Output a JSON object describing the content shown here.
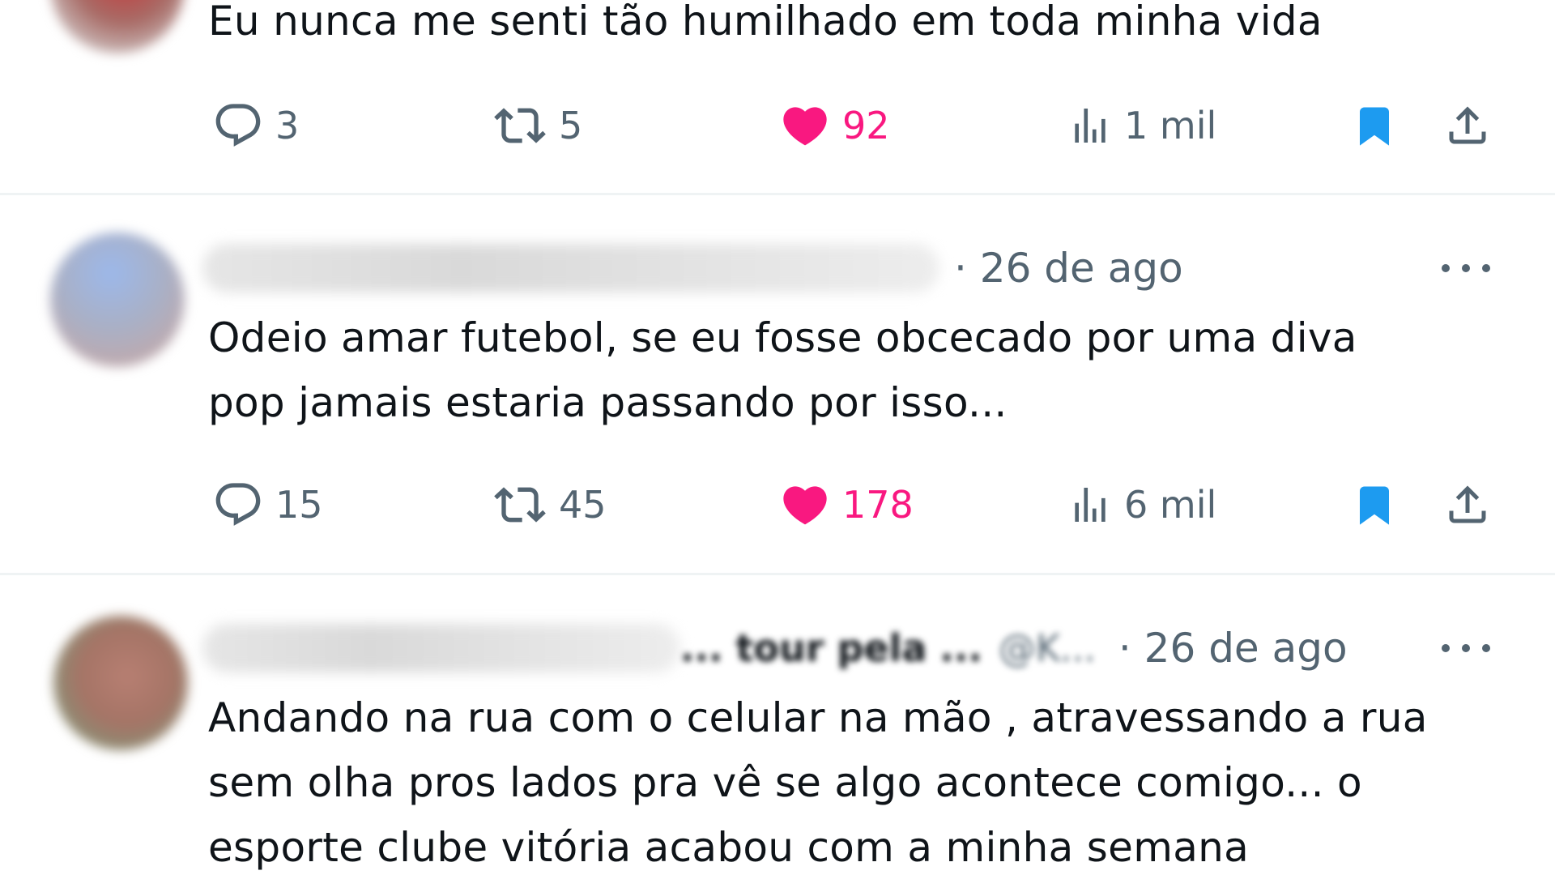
{
  "tweets": [
    {
      "text_lines": [
        "Eu nunca me senti tão humilhado em toda minha vida"
      ],
      "stats": {
        "replies": "3",
        "retweets": "5",
        "likes": "92",
        "views": "1 mil"
      }
    },
    {
      "date": "· 26 de ago",
      "text_lines": [
        "Odeio amar futebol, se eu fosse obcecado por uma diva",
        "pop jamais estaria passando por isso..."
      ],
      "stats": {
        "replies": "15",
        "retweets": "45",
        "likes": "178",
        "views": "6 mil"
      }
    },
    {
      "name_fragment": "... tour pela ...",
      "handle_fragment": "@K...",
      "date": "· 26 de ago",
      "text_lines": [
        "Andando na rua com o celular na mão , atravessando a rua",
        "sem olha pros lados pra vê se algo acontece comigo... o",
        "esporte clube vitória acabou com a minha semana"
      ]
    }
  ],
  "icons": {
    "reply": "reply-icon",
    "retweet": "retweet-icon",
    "like": "heart-icon",
    "views": "views-icon",
    "bookmark": "bookmark-icon",
    "share": "share-icon",
    "more": "more-icon"
  },
  "colors": {
    "like": "#f91880",
    "bookmark": "#1d9bf0",
    "secondary_text": "#536471",
    "divider": "#eff3f4"
  }
}
